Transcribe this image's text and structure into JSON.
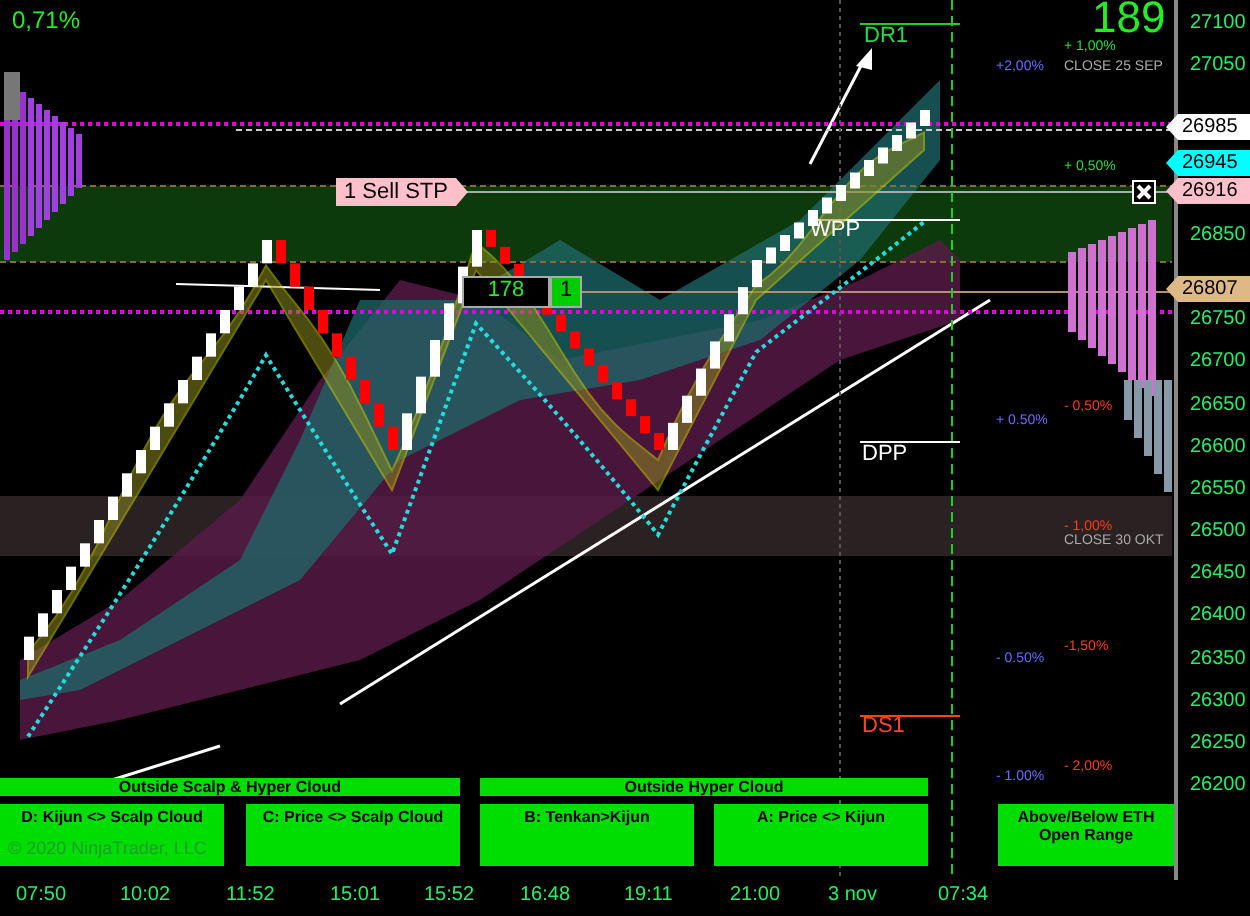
{
  "header": {
    "change": "0,71%",
    "counter": "189"
  },
  "price_axis": {
    "labels": [
      "27100",
      "27050",
      "26850",
      "26750",
      "26700",
      "26650",
      "26600",
      "26550",
      "26500",
      "26450",
      "26400",
      "26350",
      "26300",
      "26250",
      "26200"
    ]
  },
  "price_tags": [
    {
      "text": "26985",
      "color": "#ffffff"
    },
    {
      "text": "26945",
      "color": "#00ffff"
    },
    {
      "text": "26916",
      "color": "#ffc0cb"
    },
    {
      "text": "26807",
      "color": "#deb887"
    }
  ],
  "order_tag": {
    "label": "1 Sell STP"
  },
  "position": {
    "quantity": "178",
    "count": "1"
  },
  "pivots": [
    {
      "label": "DR1",
      "kind": "resistance"
    },
    {
      "label": "WPP",
      "kind": "pivot"
    },
    {
      "label": "DPP",
      "kind": "pivot"
    },
    {
      "label": "DS1",
      "kind": "support"
    }
  ],
  "percent_labels": [
    {
      "text": "+2,00%",
      "kind": "weekly"
    },
    {
      "text": "+ 1,00%",
      "kind": "up"
    },
    {
      "text": "+ 0,50%",
      "kind": "up"
    },
    {
      "text": "+ 0.50%",
      "kind": "weekly"
    },
    {
      "text": "- 0,50%",
      "kind": "down"
    },
    {
      "text": "- 1,00%",
      "kind": "down"
    },
    {
      "text": "- 0.50%",
      "kind": "weekly"
    },
    {
      "text": "-1,50%",
      "kind": "down"
    },
    {
      "text": "- 1.00%",
      "kind": "weekly"
    },
    {
      "text": "- 2,00%",
      "kind": "down"
    }
  ],
  "notes": [
    "CLOSE 25 SEP",
    "CLOSE 30 OKT"
  ],
  "signal_groups": [
    {
      "title": "Outside Scalp & Hyper Cloud"
    },
    {
      "title": "Outside Hyper Cloud"
    }
  ],
  "signals": [
    "D: Kijun <> Scalp Cloud",
    "C: Price <> Scalp Cloud",
    "B: Tenkan>Kijun",
    "A: Price <> Kijun",
    "Above/Below ETH Open Range"
  ],
  "copyright": "© 2020 NinjaTrader, LLC",
  "time_axis": {
    "labels": [
      "07:50",
      "10:02",
      "11:52",
      "15:01",
      "15:52",
      "16:48",
      "19:11",
      "21:00",
      "3 nov",
      "07:34"
    ]
  }
}
